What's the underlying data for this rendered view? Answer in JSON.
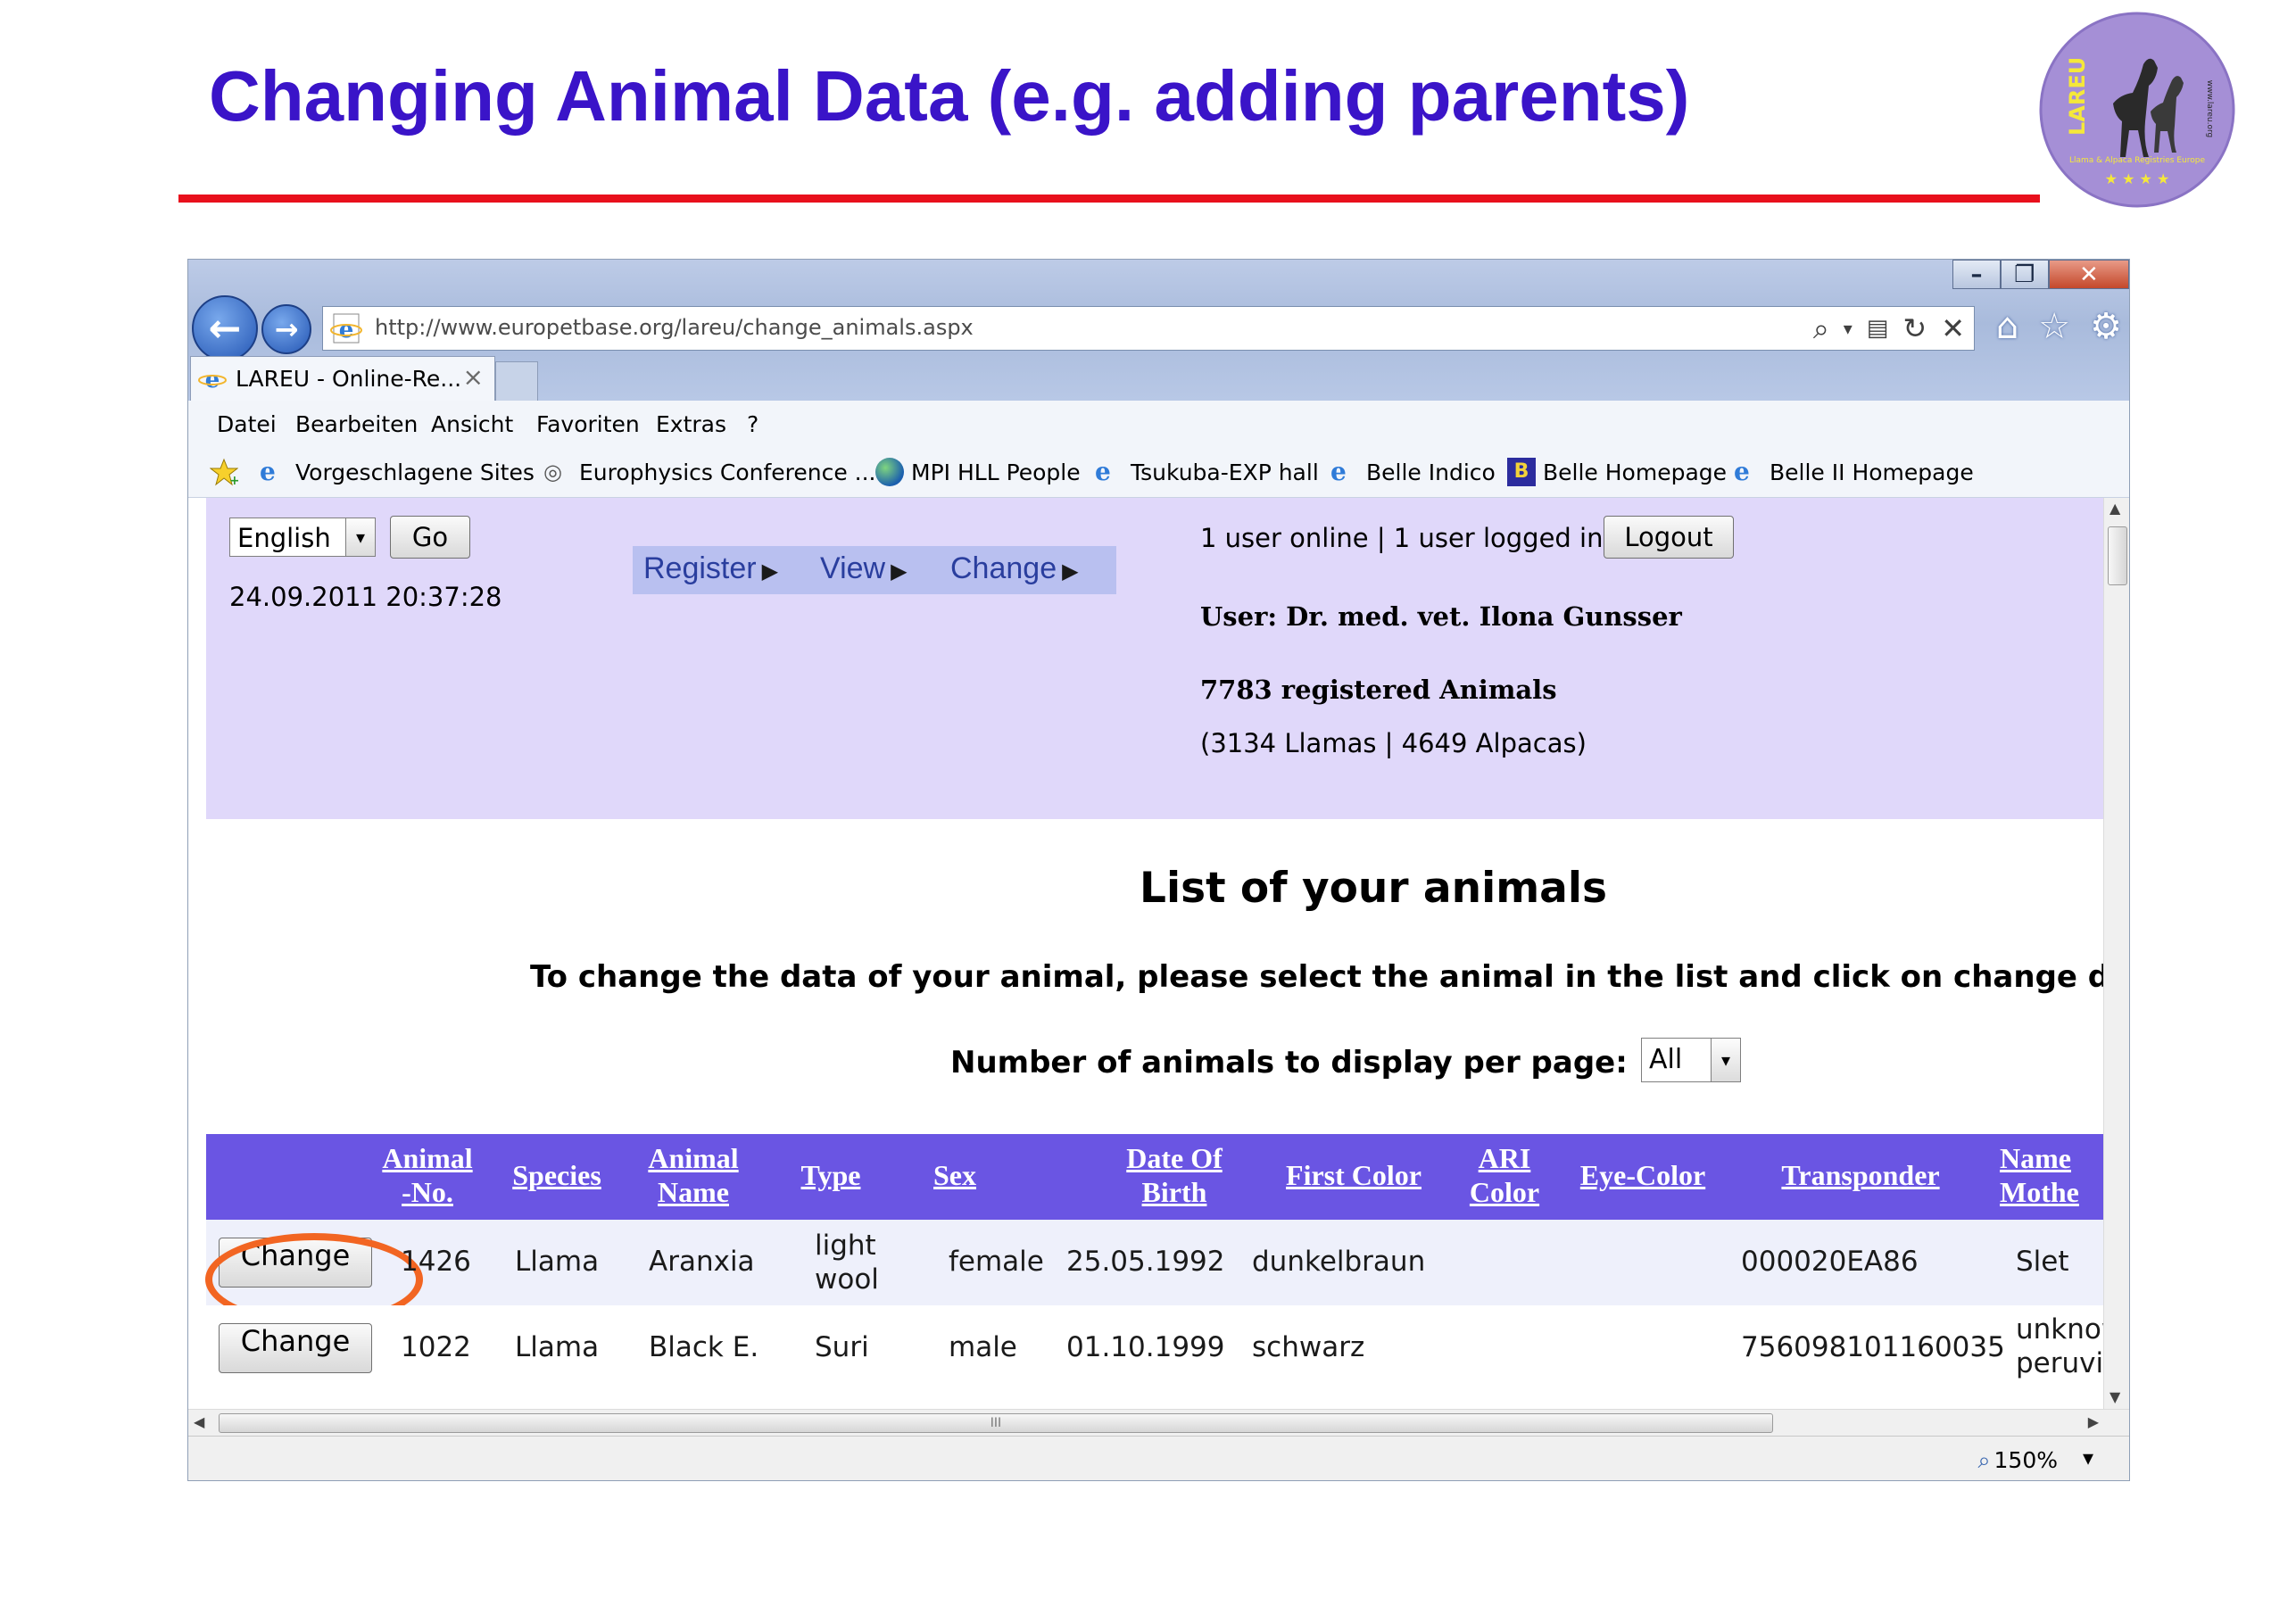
{
  "slide": {
    "title": "Changing Animal Data (e.g. adding parents)"
  },
  "browser": {
    "address": "http://www.europetbase.org/lareu/change_animals.aspx",
    "tab_label": "LAREU - Online-Re...",
    "tab_close": "×",
    "menu": [
      "Datei",
      "Bearbeiten",
      "Ansicht",
      "Favoriten",
      "Extras",
      "?"
    ],
    "favorites": [
      "Vorgeschlagene Sites",
      "Europhysics Conference ...",
      "MPI HLL People",
      "Tsukuba-EXP hall",
      "Belle Indico",
      "Belle Homepage",
      "Belle II Homepage"
    ],
    "zoom": "150%",
    "scroll_grip": "III"
  },
  "page": {
    "language": "English",
    "go_label": "Go",
    "datetime": "24.09.2011 20:37:28",
    "nav": [
      "Register",
      "View",
      "Change"
    ],
    "users_online": "1 user online | 1 user logged in",
    "logout_label": "Logout",
    "user": "User: Dr. med. vet. Ilona Gunsser",
    "animal_count": "7783 registered Animals",
    "species_count": "(3134 Llamas | 4649 Alpacas)",
    "list_heading": "List of your animals",
    "instructions": "To change the data of your animal, please select the animal in the list and click on change da",
    "per_page_label": "Number of animals to display per page:",
    "per_page_value": "All"
  },
  "table": {
    "columns": [
      "Animal -No.",
      "Species",
      "Animal Name",
      "Type",
      "Sex",
      "Date Of Birth",
      "First Color",
      "ARI Color",
      "Eye-Color",
      "Transponder",
      "Name Mothe"
    ],
    "change_label": "Change",
    "rows": [
      {
        "no": "1426",
        "species": "Llama",
        "name": "Aranxia",
        "type": "light wool",
        "sex": "female",
        "dob": "25.05.1992",
        "color": "dunkelbraun",
        "ari": "",
        "eye": "",
        "transponder": "000020EA86",
        "mother": "Slet"
      },
      {
        "no": "1022",
        "species": "Llama",
        "name": "Black E.",
        "type": "Suri",
        "sex": "male",
        "dob": "01.10.1999",
        "color": "schwarz",
        "ari": "",
        "eye": "",
        "transponder": "756098101160035",
        "mother": "unknow peruvia"
      }
    ]
  },
  "logo": {
    "text": "LAREU",
    "subtitle": "Llama & Alpaca Registries Europe",
    "url": "www.lareu.org"
  },
  "colors": {
    "title": "#3a14c8",
    "rule": "#e8101c",
    "header_bg": "#e0d8fa",
    "table_header": "#6a55e3",
    "highlight": "#f26522"
  }
}
